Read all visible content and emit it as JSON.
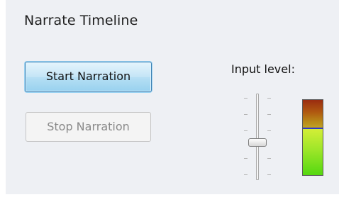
{
  "panel": {
    "title": "Narrate Timeline"
  },
  "buttons": {
    "start_label": "Start Narration",
    "stop_label": "Stop Narration",
    "stop_enabled": false
  },
  "input": {
    "label": "Input level:",
    "slider_value": 0.55,
    "meter_peak_fraction": 0.63
  },
  "colors": {
    "panel_background": "#eef0f4",
    "start_button_border": "#3c7fb1",
    "start_button_fill": "#c4e5f6",
    "disabled_text": "#8a8a8a",
    "meter_low": "#55d810",
    "meter_high": "#9a2c10",
    "meter_marker": "#2b39c9"
  }
}
